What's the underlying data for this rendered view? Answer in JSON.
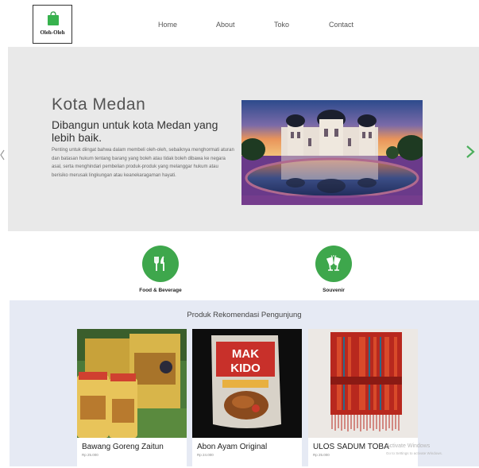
{
  "header": {
    "logo_text": "Oleh-Oleh",
    "nav": [
      "Home",
      "About",
      "Toko",
      "Contact"
    ]
  },
  "hero": {
    "title": "Kota Medan",
    "subtitle": "Dibangun untuk kota Medan yang lebih baik.",
    "description": "Penting untuk diingat bahwa dalam membeli oleh-oleh, sebaiknya menghormati aturan dan batasan hukum tentang barang yang boleh atau tidak boleh dibawa ke negara asal, serta menghindari pembelian produk-produk yang melanggar hukum atau berisiko merusak lingkungan atau keanekaragaman hayati."
  },
  "categories": [
    {
      "label": "Food & Beverage",
      "icon": "utensils-icon"
    },
    {
      "label": "Souvenir",
      "icon": "cheers-glasses-icon"
    }
  ],
  "products": {
    "heading": "Produk Rekomendasi Pengunjung",
    "items": [
      {
        "name": "Bawang Goreng Zaitun",
        "price": "Rp 25.000"
      },
      {
        "name": "Abon Ayam Original",
        "price": "Rp 24.000"
      },
      {
        "name": "ULOS SADUM TOBA",
        "price": "Rp 25.000"
      }
    ],
    "kido_label": "MAK KIDO"
  },
  "watermark": {
    "title": "Activate Windows",
    "sub": "Go to Settings to activate Windows."
  },
  "colors": {
    "accent": "#3ea74c",
    "hero_bg": "#e9e9e9",
    "products_bg": "#e6eaf4"
  }
}
